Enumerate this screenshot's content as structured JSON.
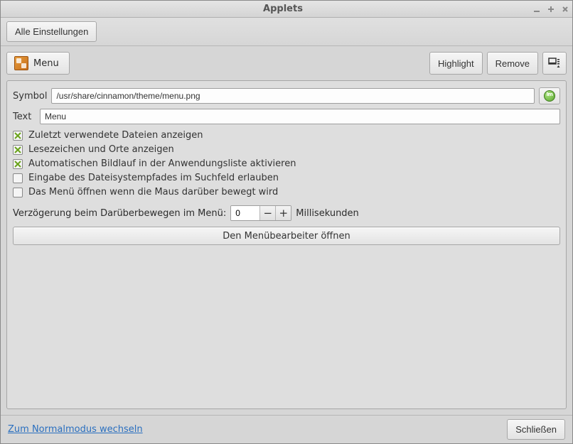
{
  "window": {
    "title": "Applets"
  },
  "topbar": {
    "all_settings": "Alle Einstellungen"
  },
  "toolbar": {
    "menu_label": "Menu",
    "highlight": "Highlight",
    "remove": "Remove"
  },
  "form": {
    "symbol_label": "Symbol",
    "symbol_value": "/usr/share/cinnamon/theme/menu.png",
    "text_label": "Text",
    "text_value": "Menu"
  },
  "checks": [
    {
      "label": "Zuletzt verwendete Dateien anzeigen",
      "checked": true
    },
    {
      "label": "Lesezeichen und Orte anzeigen",
      "checked": true
    },
    {
      "label": "Automatischen Bildlauf in der Anwendungsliste aktivieren",
      "checked": true
    },
    {
      "label": "Eingabe des Dateisystempfades im Suchfeld erlauben",
      "checked": false
    },
    {
      "label": "Das Menü öffnen wenn die Maus darüber bewegt wird",
      "checked": false
    }
  ],
  "delay": {
    "label": "Verzögerung beim Darüberbewegen im Menü:",
    "value": "0",
    "unit": "Millisekunden"
  },
  "editor_button": "Den Menübearbeiter öffnen",
  "footer": {
    "normal_mode_link": "Zum Normalmodus wechseln",
    "close": "Schließen"
  }
}
